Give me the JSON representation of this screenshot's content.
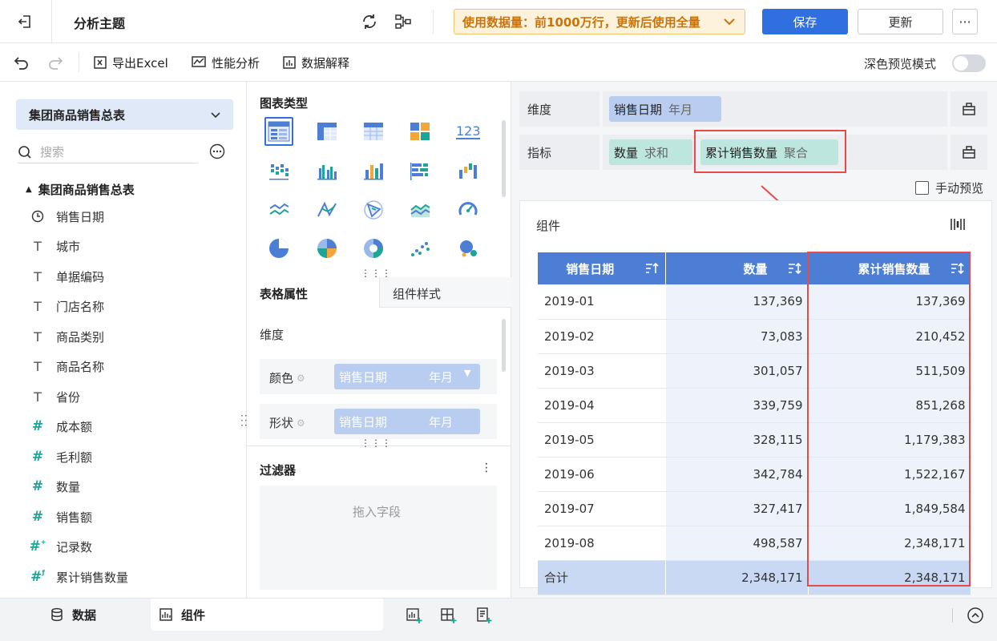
{
  "header": {
    "title": "分析主题",
    "data_notice": "使用数据量：前1000万行，更新后使用全量",
    "save_label": "保存",
    "update_label": "更新",
    "more_label": "···"
  },
  "toolbar": {
    "export_label": "导出Excel",
    "perf_label": "性能分析",
    "explain_label": "数据解释",
    "dark_mode_label": "深色预览模式"
  },
  "data_panel": {
    "dataset": "集团商品销售总表",
    "search_placeholder": "搜索",
    "tree_root": "集团商品销售总表",
    "fields": [
      {
        "name": "销售日期",
        "type": "date"
      },
      {
        "name": "城市",
        "type": "text"
      },
      {
        "name": "单据编码",
        "type": "text"
      },
      {
        "name": "门店名称",
        "type": "text"
      },
      {
        "name": "商品类别",
        "type": "text"
      },
      {
        "name": "商品名称",
        "type": "text"
      },
      {
        "name": "省份",
        "type": "text"
      },
      {
        "name": "成本额",
        "type": "number"
      },
      {
        "name": "毛利额",
        "type": "number"
      },
      {
        "name": "数量",
        "type": "number"
      },
      {
        "name": "销售额",
        "type": "number"
      },
      {
        "name": "记录数",
        "type": "calc"
      },
      {
        "name": "累计销售数量",
        "type": "calc"
      }
    ]
  },
  "chart_panel": {
    "chart_type_title": "图表类型",
    "tab_table_props": "表格属性",
    "tab_widget_style": "组件样式",
    "dimension_label": "维度",
    "color_label": "颜色",
    "shape_label": "形状",
    "chip_field": "销售日期",
    "chip_granularity": "年月",
    "filter_title": "过滤器",
    "filter_placeholder": "拖入字段"
  },
  "config": {
    "dimension_label": "维度",
    "dimension_pill": {
      "field": "销售日期",
      "agg": "年月"
    },
    "metric_label": "指标",
    "metric_pills": [
      {
        "field": "数量",
        "agg": "求和"
      },
      {
        "field": "累计销售数量",
        "agg": "聚合"
      }
    ],
    "manual_preview_label": "手动预览"
  },
  "widget": {
    "title": "组件",
    "columns": [
      "销售日期",
      "数量",
      "累计销售数量"
    ],
    "rows": [
      {
        "date": "2019-01",
        "qty": "137,369",
        "cum": "137,369"
      },
      {
        "date": "2019-02",
        "qty": "73,083",
        "cum": "210,452"
      },
      {
        "date": "2019-03",
        "qty": "301,057",
        "cum": "511,509"
      },
      {
        "date": "2019-04",
        "qty": "339,759",
        "cum": "851,268"
      },
      {
        "date": "2019-05",
        "qty": "328,115",
        "cum": "1,179,383"
      },
      {
        "date": "2019-06",
        "qty": "342,784",
        "cum": "1,522,167"
      },
      {
        "date": "2019-07",
        "qty": "327,417",
        "cum": "1,849,584"
      },
      {
        "date": "2019-08",
        "qty": "498,587",
        "cum": "2,348,171"
      }
    ],
    "total": {
      "label": "合计",
      "qty": "2,348,171",
      "cum": "2,348,171"
    }
  },
  "bottom": {
    "data_tab": "数据",
    "widget_tab": "组件"
  },
  "colors": {
    "primary": "#2f6fe0",
    "header_blue": "#4d7ed6",
    "teal": "#1ea596",
    "highlight_red": "#e84a4a"
  }
}
